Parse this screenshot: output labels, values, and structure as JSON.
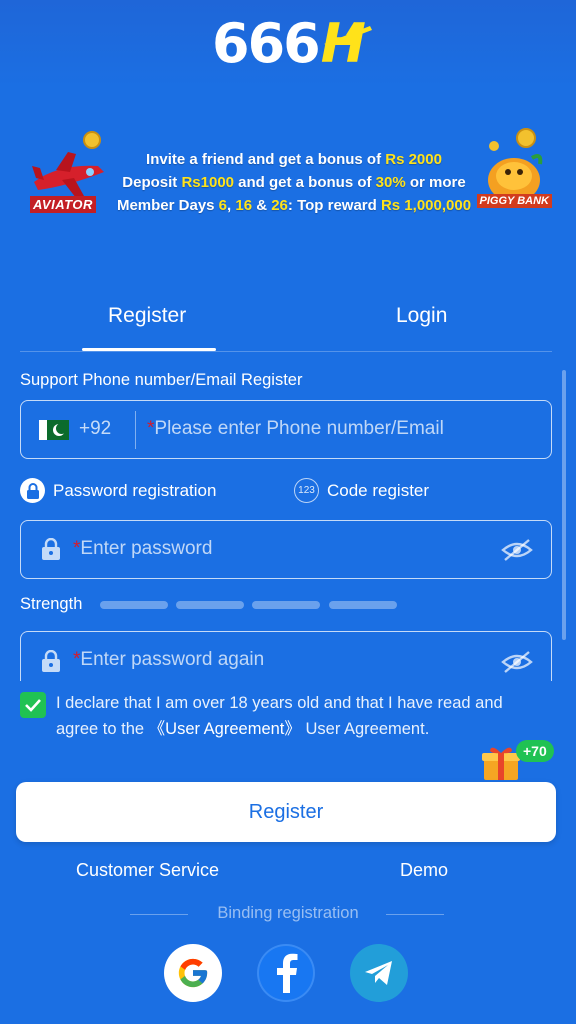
{
  "header": {
    "logo_text": "666",
    "logo_letter": "H"
  },
  "banner": {
    "line1_prefix": "Invite a friend and get a bonus of ",
    "line1_amount": "Rs 2000",
    "line2_prefix": "Deposit ",
    "line2_deposit": "Rs1000",
    "line2_mid": " and get a bonus of ",
    "line2_percent": "30%",
    "line2_suffix": " or more",
    "line3_prefix": "Member Days ",
    "line3_day1": "6",
    "line3_sep1": ", ",
    "line3_day2": "16",
    "line3_sep2": " & ",
    "line3_day3": "26",
    "line3_mid": ": Top reward ",
    "line3_reward": "Rs 1,000,000",
    "aviator_label": "AVIATOR",
    "piggy_label": "PIGGY BANK"
  },
  "tabs": {
    "register": "Register",
    "login": "Login"
  },
  "form": {
    "section_label": "Support Phone number/Email Register",
    "country_code": "+92",
    "required_mark": "*",
    "phone_placeholder": "Please enter Phone number/Email",
    "mode_password": "Password registration",
    "mode_code": "Code register",
    "code_icon_text": "123",
    "password_placeholder": "Enter password",
    "strength_label": "Strength",
    "password_again_placeholder": "Enter password again",
    "agree_text_1": "I declare that I am over 18 years old and that I have read and agree to the ",
    "agree_link": "《User Agreement》",
    "agree_text_2": " User Agreement.",
    "agree_checked": true
  },
  "gift": {
    "badge": "+70"
  },
  "register_button": "Register",
  "links": {
    "customer_service": "Customer Service",
    "demo": "Demo"
  },
  "binding_label": "Binding registration",
  "social": [
    "google-icon",
    "facebook-icon",
    "telegram-icon"
  ],
  "colors": {
    "background": "#1b6fe3",
    "accent_yellow": "#ffe21a",
    "required_red": "#d41c2c",
    "check_green": "#20c253"
  }
}
